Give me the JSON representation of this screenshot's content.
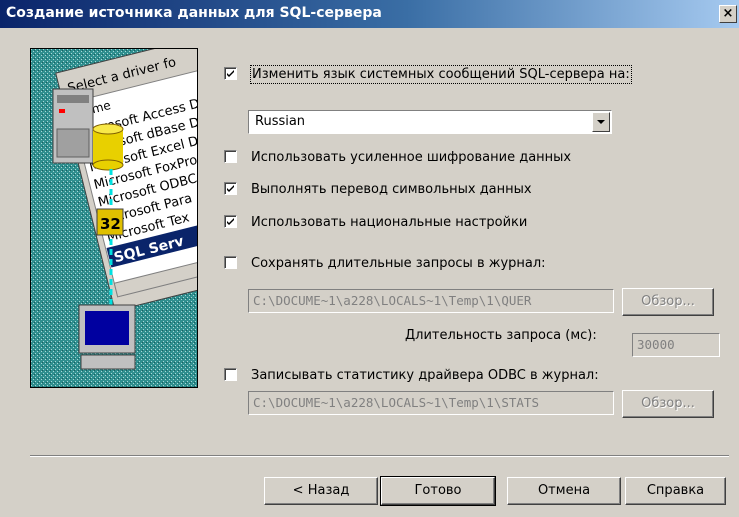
{
  "window": {
    "title": "Создание источника данных для SQL-сервера",
    "close_label": "×"
  },
  "image": {
    "driver_label": "Select a driver fo",
    "header": "Name",
    "drivers": [
      "Microsoft Access D",
      "Microsoft dBase D",
      "Microsoft Excel D",
      "Microsoft FoxPro",
      "Microsoft ODBC",
      "Microsoft Para",
      "Microsoft Tex"
    ],
    "selected": "SQL Serv",
    "badge": "32"
  },
  "options": {
    "change_language": {
      "label": "Изменить язык системных сообщений SQL-сервера на:",
      "checked": true
    },
    "language": {
      "value": "Russian"
    },
    "strong_encryption": {
      "label": "Использовать усиленное шифрование данных",
      "checked": false
    },
    "translate_chars": {
      "label": "Выполнять перевод символьных данных",
      "checked": true
    },
    "regional_settings": {
      "label": "Использовать национальные настройки",
      "checked": true
    },
    "log_long_queries": {
      "label": "Сохранять длительные запросы в журнал:",
      "checked": false
    },
    "query_log_path": "C:\\DOCUME~1\\a228\\LOCALS~1\\Temp\\1\\QUER",
    "browse_query_label": "Обзор...",
    "query_duration_label": "Длительность запроса (мс):",
    "query_duration_value": "30000",
    "log_stats": {
      "label": "Записывать статистику драйвера ODBC в журнал:",
      "checked": false
    },
    "stats_log_path": "C:\\DOCUME~1\\a228\\LOCALS~1\\Temp\\1\\STATS",
    "browse_stats_label": "Обзор..."
  },
  "buttons": {
    "back": "< Назад",
    "finish": "Готово",
    "cancel": "Отмена",
    "help": "Справка"
  }
}
